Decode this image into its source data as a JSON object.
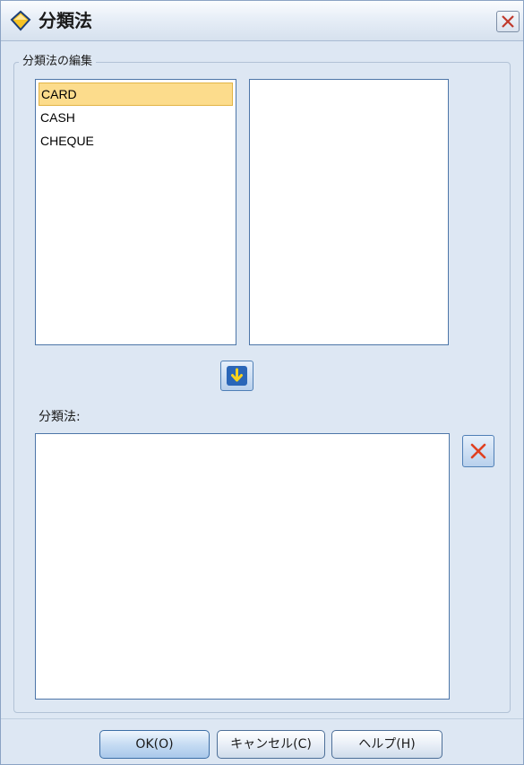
{
  "window": {
    "title": "分類法",
    "close_label": "✕"
  },
  "editor_group": {
    "label": "分類法の編集"
  },
  "available_list": {
    "items": [
      {
        "label": "CARD",
        "selected": true
      },
      {
        "label": "CASH",
        "selected": false
      },
      {
        "label": "CHEQUE",
        "selected": false
      }
    ]
  },
  "classification": {
    "label": "分類法:",
    "items": []
  },
  "buttons": {
    "ok": "OK(O)",
    "cancel": "キャンセル(C)",
    "help": "ヘルプ(H)"
  },
  "icons": {
    "app": "diamond-app-icon",
    "close": "close-icon",
    "move_down": "arrow-down-icon",
    "remove": "delete-x-icon"
  },
  "colors": {
    "selection_fill": "#fcdc8c",
    "arrow_yellow": "#f7d21c",
    "remove_red": "#e04020"
  }
}
